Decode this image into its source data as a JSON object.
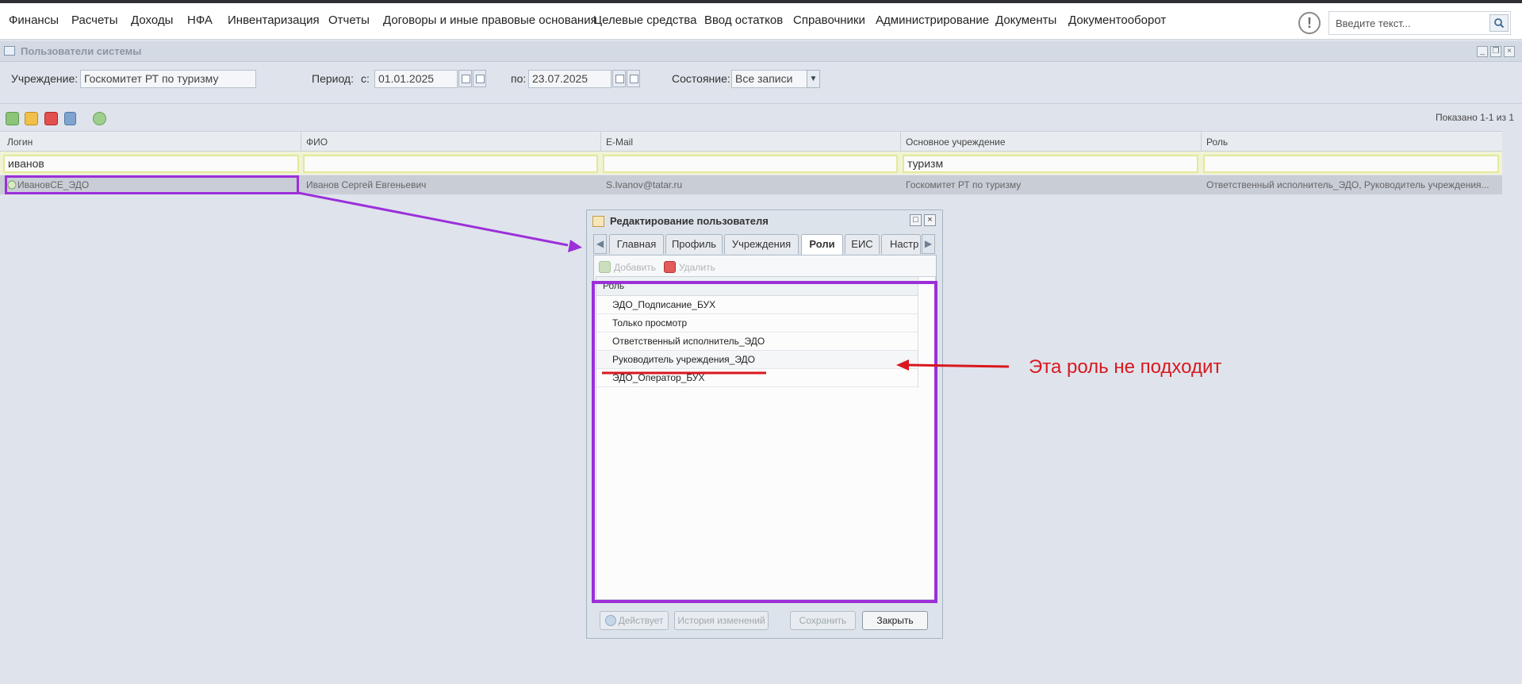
{
  "menu": {
    "items": [
      "Финансы",
      "Расчеты",
      "Доходы",
      "НФА",
      "Инвентаризация",
      "Отчеты",
      "Договоры и иные правовые основания",
      "Целевые средства",
      "Ввод остатков",
      "Справочники",
      "Администрирование",
      "Документы",
      "Документооборот"
    ],
    "alert_glyph": "!",
    "search_placeholder": "Введите текст..."
  },
  "window": {
    "title": "Пользователи системы"
  },
  "filters": {
    "institution_label": "Учреждение:",
    "institution_value": "Госкомитет РТ по туризму",
    "period_label": "Период:",
    "from_label": "с:",
    "from_value": "01.01.2025",
    "to_label": "по:",
    "to_value": "23.07.2025",
    "state_label": "Состояние:",
    "state_value": "Все записи"
  },
  "grid": {
    "shown_count": "Показано 1-1 из 1",
    "columns": [
      "Логин",
      "ФИО",
      "E-Mail",
      "Основное учреждение",
      "Роль"
    ],
    "filter_values": [
      "иванов",
      "",
      "",
      "туризм",
      ""
    ],
    "rows": [
      [
        "ИвановСЕ_ЭДО",
        "Иванов Сергей Евгеньевич",
        "S.Ivanov@tatar.ru",
        "Госкомитет РТ по туризму",
        "Ответственный исполнитель_ЭДО, Руководитель учреждения..."
      ]
    ]
  },
  "dialog": {
    "title": "Редактирование пользователя",
    "tabs": [
      "Главная",
      "Профиль",
      "Учреждения",
      "Роли",
      "ЕИС",
      "Настр"
    ],
    "active_tab": "Роли",
    "add_label": "Добавить",
    "delete_label": "Удалить",
    "roles_header": "Роль",
    "roles": [
      "ЭДО_Подписание_БУХ",
      "Только просмотр",
      "Ответственный исполнитель_ЭДО",
      "Руководитель учреждения_ЭДО",
      "ЭДО_Оператор_БУХ"
    ],
    "buttons": {
      "active": "Действует",
      "history": "История изменений",
      "save": "Сохранить",
      "close": "Закрыть"
    }
  },
  "annotation": {
    "text": "Эта роль не подходит",
    "color": "#d8181e",
    "highlight_color": "#9b30d9"
  }
}
